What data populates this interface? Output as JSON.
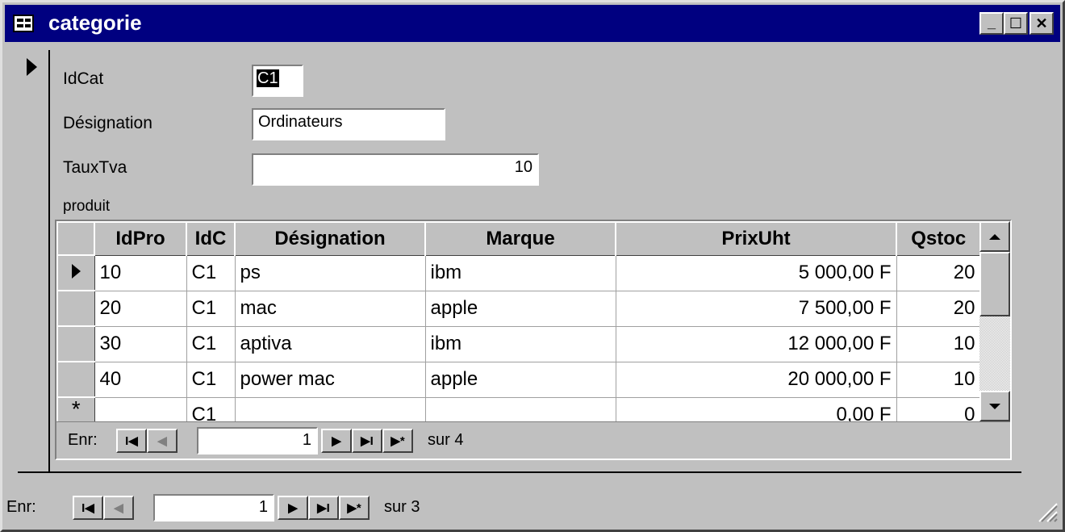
{
  "window": {
    "title": "categorie",
    "icon": "form-icon",
    "controls": {
      "minimize": "_",
      "maximize": "☐",
      "close": "✕"
    }
  },
  "form": {
    "fields": [
      {
        "label": "IdCat",
        "value": "C1"
      },
      {
        "label": "Désignation",
        "value": "Ordinateurs"
      },
      {
        "label": "TauxTva",
        "value": "10"
      }
    ],
    "subform_label": "produit"
  },
  "subform": {
    "columns": [
      "IdPro",
      "IdC",
      "Désignation",
      "Marque",
      "PrixUht",
      "Qstoc"
    ],
    "rows": [
      {
        "selector": "current",
        "cells": [
          "10",
          "C1",
          "ps",
          "ibm",
          "5 000,00 F",
          "20"
        ]
      },
      {
        "selector": "",
        "cells": [
          "20",
          "C1",
          "mac",
          "apple",
          "7 500,00 F",
          "20"
        ]
      },
      {
        "selector": "",
        "cells": [
          "30",
          "C1",
          "aptiva",
          "ibm",
          "12 000,00 F",
          "10"
        ]
      },
      {
        "selector": "",
        "cells": [
          "40",
          "C1",
          "power mac",
          "apple",
          "20 000,00 F",
          "10"
        ]
      },
      {
        "selector": "*",
        "cells": [
          "",
          "C1",
          "",
          "",
          "0,00 F",
          "0"
        ]
      }
    ],
    "nav": {
      "label": "Enr:",
      "record": "1",
      "of_text": "sur 4"
    }
  },
  "main_nav": {
    "label": "Enr:",
    "record": "1",
    "of_text": "sur 3"
  },
  "nav_buttons": {
    "first": "I◀",
    "prev": "◀",
    "next": "▶",
    "last": "▶I",
    "new": "▶*"
  },
  "colors": {
    "title_bar": "#000080",
    "face": "#c0c0c0",
    "field": "#ffffff"
  }
}
